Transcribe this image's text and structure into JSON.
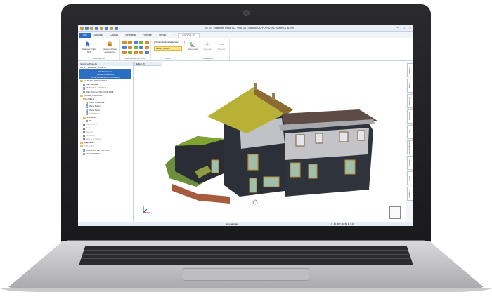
{
  "window": {
    "title": "RS_07_Esistente_Mista_LL - Vista 3D - Edificio CA+PD+PD+AC+Mistr+LS 3D/Rn"
  },
  "ribbon_tabs": [
    "File",
    "Disegno",
    "Calcolo",
    "Strumenti",
    "Finestre",
    "Servizi",
    "?",
    "EDITOR 3D"
  ],
  "ribbon": {
    "groups": [
      {
        "label": "Strumenti 3D",
        "buttons": [
          "Vedi/nasc. CEL / OFF",
          "Assegna Piano Automatico"
        ]
      },
      {
        "label": "Visibilità per tipo entità",
        "buttons": []
      },
      {
        "label": "Texture",
        "dropdown": "Texture/Colore/Materiale",
        "button": "Mostra Texture"
      },
      {
        "label": "Assi Locali",
        "buttons": [
          "Assi Locali",
          "Aggiungi",
          "Rimuovi"
        ]
      }
    ]
  },
  "left_panel": {
    "header": "Gestione Progetto",
    "project": "RS_07_Esistente_Mista_LL",
    "selection": [
      "SEZIONI CAD",
      "[Struttura Edificio]",
      "[Dimensionamento di Progetto]"
    ],
    "tree": [
      {
        "label": "DATI della STRUTTURA",
        "dim": false,
        "icon": "fld"
      },
      {
        "label": "Dati Generali",
        "dim": false,
        "icon": "doc"
      },
      {
        "label": "Preferenze di Calcolo",
        "dim": false,
        "icon": "doc"
      },
      {
        "label": "Dati Norma (NTC) D.M. 2008",
        "dim": false,
        "icon": "doc"
      },
      {
        "label": "PROGETTAZIONE",
        "dim": false,
        "icon": "fld"
      },
      {
        "label": "LIVELLI",
        "dim": false,
        "icon": "fld"
      },
      {
        "label": "Piano Copertura",
        "dim": false,
        "icon": "doc"
      },
      {
        "label": "Piano Primo",
        "dim": false,
        "icon": "doc"
      },
      {
        "label": "Piano Terra",
        "dim": false,
        "icon": "doc"
      },
      {
        "label": "Fondazione",
        "dim": false,
        "icon": "doc"
      },
      {
        "label": "VISTE 3D",
        "dim": false,
        "icon": "fld"
      },
      {
        "label": "3D",
        "dim": false,
        "icon": "doc"
      },
      {
        "label": "Carpenterie",
        "dim": true,
        "icon": "sq"
      },
      {
        "label": "Telai",
        "dim": true,
        "icon": "sq"
      },
      {
        "label": "Sezioni",
        "dim": true,
        "icon": "sq"
      },
      {
        "label": "Armature",
        "dim": true,
        "icon": "sq"
      },
      {
        "label": "Tavole Grafiche",
        "dim": true,
        "icon": "sq"
      },
      {
        "label": "ELEMENTI",
        "dim": false,
        "icon": "fld"
      },
      {
        "label": "RISULTATI",
        "dim": true,
        "icon": "fld"
      },
      {
        "label": "RISULTATI del CALCOLO",
        "dim": false,
        "icon": "doc"
      },
      {
        "label": "DIAGNOSTICA",
        "dim": false,
        "icon": "doc"
      }
    ]
  },
  "viewport": {
    "tab": "Editor 3D"
  },
  "right_tabs": [
    "Tabelle",
    "Sfondi (Background)",
    "Gestione Attributi",
    "Gestione Entità",
    "Filtri",
    "Configurazioni",
    "Sezioni",
    "Ferro",
    "Progetto"
  ],
  "status": {
    "left": "Non calcolato",
    "right": "X: 40.00 Y: 10.58 Z: 0.00"
  }
}
